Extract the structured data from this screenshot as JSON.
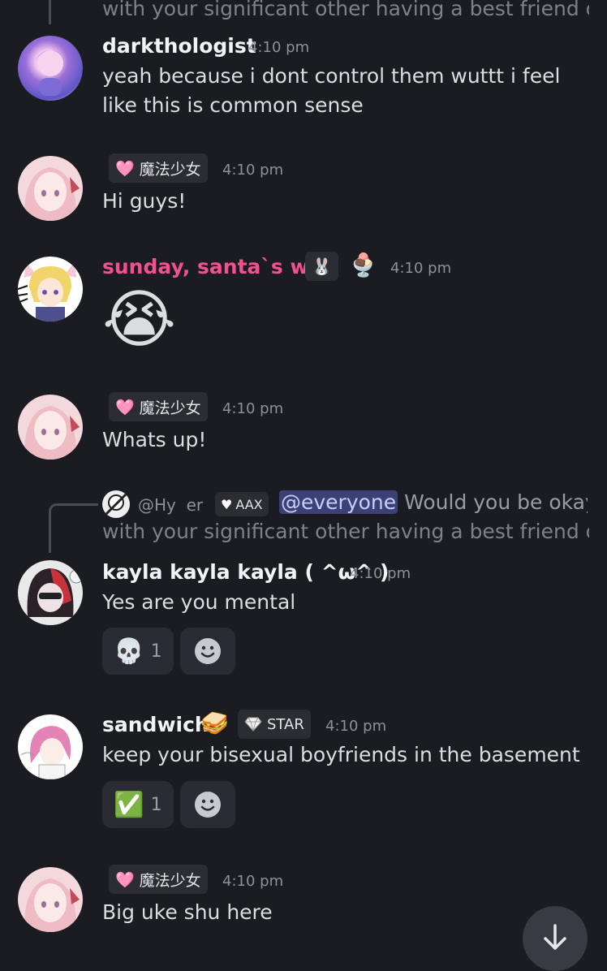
{
  "messages": [
    {
      "reply_continuation": "with your significant other having a best friend o...",
      "author": "darkthologist",
      "time": "4:10 pm",
      "text": "yeah because i dont control them wuttt i feel like this is common sense"
    },
    {
      "tag_label": "魔法少女",
      "time": "4:10 pm",
      "text": "Hi guys!"
    },
    {
      "author": "sunday, santa`s wife",
      "author_color": "#f0528f",
      "time": "4:10 pm",
      "emoji": "😭"
    },
    {
      "tag_label": "魔法少女",
      "time": "4:10 pm",
      "text": "Whats up!"
    },
    {
      "reply": {
        "user": "@Hy  er",
        "tag": "AAX",
        "mention": "@everyone",
        "text": "Would you be okay",
        "continuation": "with your significant other having a best friend o..."
      },
      "author": "kayla kayla kayla ( ^ω^ )",
      "time": "4:10 pm",
      "text": "Yes are you mental",
      "reaction": {
        "emoji": "💀",
        "count": "1"
      }
    },
    {
      "author": "sandwich",
      "author_emoji": "🥪",
      "tag_label": "STAR",
      "time": "4:10 pm",
      "text": "keep your bisexual boyfriends in the basement",
      "reaction": {
        "emoji": "✅",
        "count": "1"
      }
    },
    {
      "tag_label": "魔法少女",
      "time": "4:10 pm",
      "text": "Big uke shu here"
    }
  ],
  "icons": {
    "heart_tag": "🩷",
    "add_reaction": "smiley-add-icon",
    "scroll_down": "arrow-down-icon",
    "bunny_badge": "🐰",
    "sundae_badge": "🍨",
    "diamond": "diamond-icon"
  },
  "colors": {
    "background": "#1b1c21",
    "mention_bg": "#3b4174",
    "accent_pink": "#f0528f"
  }
}
